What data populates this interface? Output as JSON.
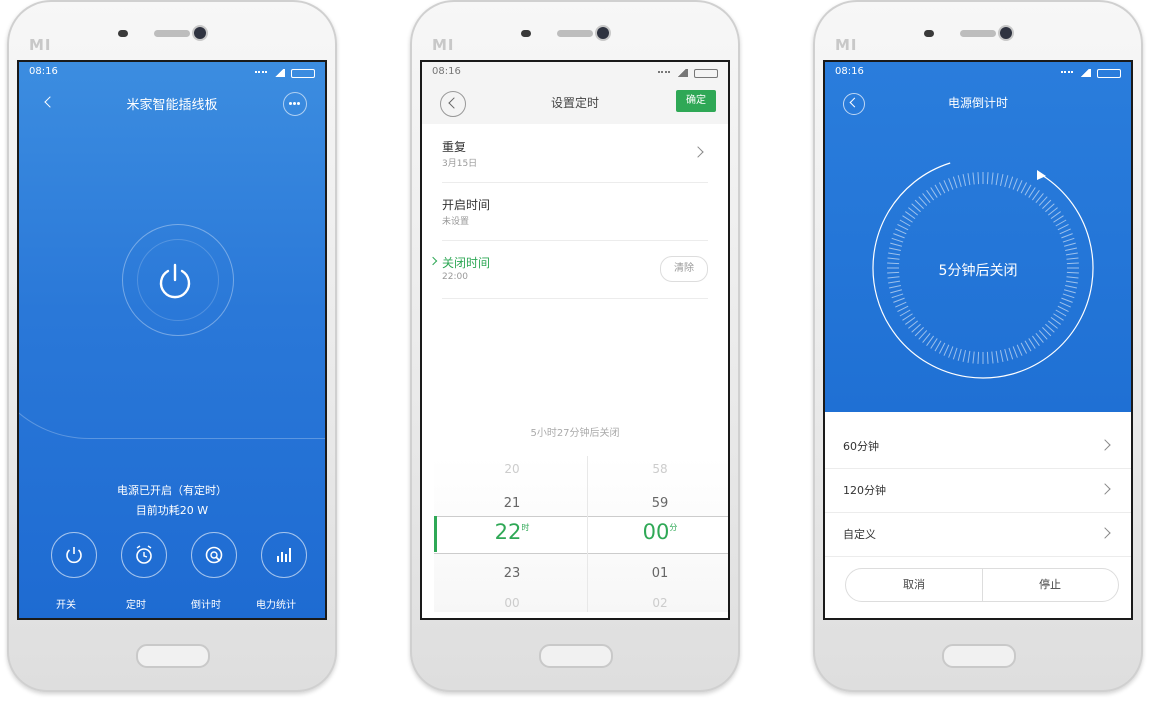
{
  "common": {
    "status_time": "08:16",
    "brand": "MI"
  },
  "screen1": {
    "title": "米家智能插线板",
    "status_line": "电源已开启（有定时）",
    "power_line": "目前功耗20 W",
    "buttons": [
      {
        "label": "开关",
        "icon": "power-icon"
      },
      {
        "label": "定时",
        "icon": "alarm-clock-icon"
      },
      {
        "label": "倒计时",
        "icon": "countdown-icon"
      },
      {
        "label": "电力统计",
        "icon": "bar-chart-icon"
      }
    ]
  },
  "screen2": {
    "title": "设置定时",
    "confirm_label": "确定",
    "rows": [
      {
        "title": "重复",
        "sub": "3月15日"
      },
      {
        "title": "开启时间",
        "sub": "未设置"
      },
      {
        "title": "关闭时间",
        "sub": "22:00",
        "action": "清除"
      }
    ],
    "remain_text": "5小时27分钟后关闭",
    "hour_column": {
      "above2": "20",
      "above1": "21",
      "selected": "22",
      "unit": "时",
      "below1": "23",
      "below2": "00"
    },
    "minute_column": {
      "above2": "58",
      "above1": "59",
      "selected": "00",
      "unit": "分",
      "below1": "01",
      "below2": "02"
    },
    "accent": "#2fa856"
  },
  "screen3": {
    "title": "电源倒计时",
    "dial_text": "5分钟后关闭",
    "options": [
      "60分钟",
      "120分钟",
      "自定义"
    ],
    "cancel_label": "取消",
    "stop_label": "停止",
    "accent": "#1f70d4"
  }
}
